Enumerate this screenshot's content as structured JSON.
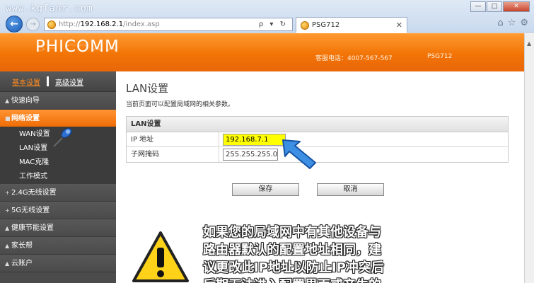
{
  "browser": {
    "watermark": "www.kgfanr.com",
    "url_proto": "http://",
    "url_host": "192.168.2.1",
    "url_path": "/index.asp",
    "addr_tools": "ρ ▾ ↻",
    "tab_title": "PSG712",
    "tab_close": "✕",
    "back": "←",
    "forward": "→",
    "win_min": "—",
    "win_max": "□",
    "win_close": "✕",
    "icons": {
      "home": "⌂",
      "favorites": "☆",
      "settings": "⚙"
    }
  },
  "header": {
    "logo": "PHICOMM",
    "hotline": "客服电话：4007-567-567",
    "model": "PSG712",
    "bg_color": "#f27406"
  },
  "sidebar": {
    "tab_basic": "基本设置",
    "tab_advanced": "高级设置",
    "items": [
      {
        "label": "快速向导",
        "icon": "▲"
      },
      {
        "label": "网络设置",
        "icon": "■",
        "active": true
      },
      {
        "label": "2.4G无线设置",
        "icon": "+"
      },
      {
        "label": "5G无线设置",
        "icon": "+"
      },
      {
        "label": "健康节能设置",
        "icon": "▲"
      },
      {
        "label": "家长帮",
        "icon": "▲"
      },
      {
        "label": "云账户",
        "icon": "▲"
      }
    ],
    "sub_items": [
      "WAN设置",
      "LAN设置",
      "MAC克隆",
      "工作模式"
    ]
  },
  "main": {
    "title": "LAN设置",
    "description": "当前页面可以配置局域网的相关参数。",
    "table_header": "LAN设置",
    "ip_label": "IP 地址",
    "ip_value": "192.168.7.1",
    "mask_label": "子网掩码",
    "mask_value": "255.255.255.0",
    "save_label": "保存",
    "cancel_label": "取消"
  },
  "annotation": {
    "line1": "如果您的局域网中有其他设备与",
    "line2": "路由器默认的配置地址相同，建",
    "line3": "议更改此IP地址以防止IP冲突后",
    "line4": "后期无法进入配置界面或产生的"
  }
}
